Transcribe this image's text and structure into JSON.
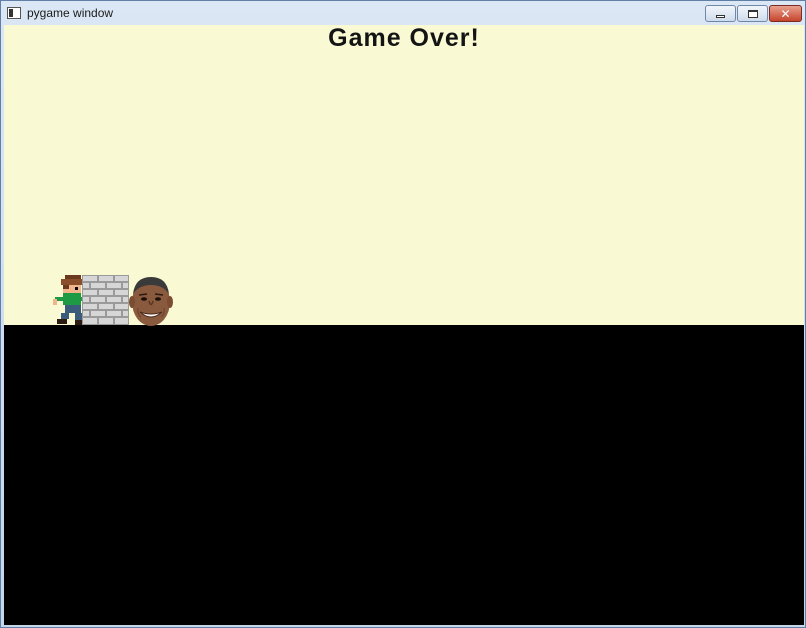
{
  "window": {
    "title": "pygame window",
    "icon": "app-icon",
    "controls": [
      "minimize-icon",
      "maximize-icon",
      "close-icon"
    ]
  },
  "game": {
    "message": "Game Over!",
    "colors": {
      "sky": "#f9f9d3",
      "ground": "#000000",
      "text": "#141414"
    },
    "sprites": [
      "player-icon",
      "brick-wall",
      "enemy-head"
    ]
  }
}
